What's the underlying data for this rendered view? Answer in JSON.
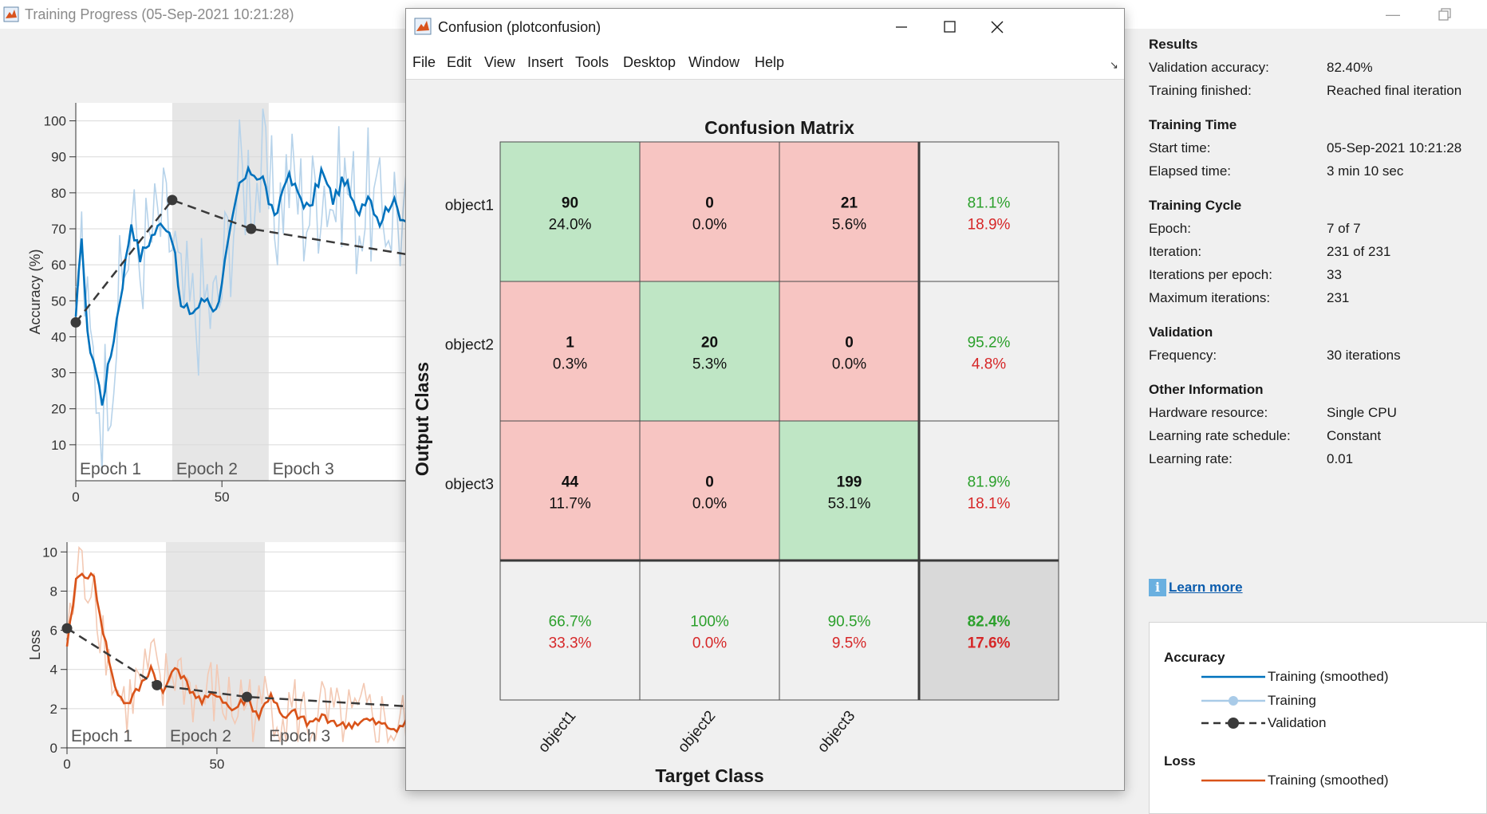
{
  "training_window": {
    "title": "Training Progress (05-Sep-2021 10:21:28)",
    "min_glyph": "—"
  },
  "accuracy_plot": {
    "ylabel": "Accuracy (%)",
    "y_ticks": [
      "10",
      "20",
      "30",
      "40",
      "50",
      "60",
      "70",
      "80",
      "90",
      "100"
    ],
    "x_ticks": [
      "0",
      "50"
    ],
    "epoch_labels": [
      "Epoch 1",
      "Epoch 2",
      "Epoch 3"
    ],
    "validation_points": [
      [
        0,
        44
      ],
      [
        33,
        78
      ],
      [
        60,
        70
      ]
    ]
  },
  "loss_plot": {
    "ylabel": "Loss",
    "y_ticks": [
      "0",
      "2",
      "4",
      "6",
      "8",
      "10"
    ],
    "x_ticks": [
      "0",
      "50"
    ],
    "epoch_labels": [
      "Epoch 1",
      "Epoch 2",
      "Epoch 3"
    ],
    "validation_points": [
      [
        0,
        6.1
      ],
      [
        30,
        3.2
      ],
      [
        60,
        2.6
      ]
    ]
  },
  "results": {
    "sections": [
      {
        "heading": "Results",
        "rows": [
          {
            "label": "Validation accuracy:",
            "value": "82.40%"
          },
          {
            "label": "Training finished:",
            "value": "Reached final iteration"
          }
        ]
      },
      {
        "heading": "Training Time",
        "rows": [
          {
            "label": "Start time:",
            "value": "05-Sep-2021 10:21:28"
          },
          {
            "label": "Elapsed time:",
            "value": "3 min 10 sec"
          }
        ]
      },
      {
        "heading": "Training Cycle",
        "rows": [
          {
            "label": "Epoch:",
            "value": "7 of 7"
          },
          {
            "label": "Iteration:",
            "value": "231 of 231"
          },
          {
            "label": "Iterations per epoch:",
            "value": "33"
          },
          {
            "label": "Maximum iterations:",
            "value": "231"
          }
        ]
      },
      {
        "heading": "Validation",
        "rows": [
          {
            "label": "Frequency:",
            "value": "30 iterations"
          }
        ]
      },
      {
        "heading": "Other Information",
        "rows": [
          {
            "label": "Hardware resource:",
            "value": "Single CPU"
          },
          {
            "label": "Learning rate schedule:",
            "value": "Constant"
          },
          {
            "label": "Learning rate:",
            "value": "0.01"
          }
        ]
      }
    ],
    "info_glyph": "i",
    "learn_more": "Learn more"
  },
  "legend": {
    "accuracy_heading": "Accuracy",
    "loss_heading": "Loss",
    "training_smoothed": "Training (smoothed)",
    "training": "Training",
    "validation": "Validation",
    "loss_training_smoothed": "Training (smoothed)"
  },
  "figure": {
    "title": "Confusion (plotconfusion)",
    "menu": [
      "File",
      "Edit",
      "View",
      "Insert",
      "Tools",
      "Desktop",
      "Window",
      "Help"
    ],
    "dock_glyph": "↘"
  },
  "chart_data": {
    "type": "heatmap",
    "title": "Confusion Matrix",
    "xlabel": "Target Class",
    "ylabel": "Output Class",
    "classes": [
      "object1",
      "object2",
      "object3"
    ],
    "counts": [
      [
        90,
        0,
        21
      ],
      [
        1,
        20,
        0
      ],
      [
        44,
        0,
        199
      ]
    ],
    "percents": [
      [
        "24.0%",
        "0.0%",
        "5.6%"
      ],
      [
        "0.3%",
        "5.3%",
        "0.0%"
      ],
      [
        "11.7%",
        "0.0%",
        "53.1%"
      ]
    ],
    "row_summary": [
      [
        "81.1%",
        "18.9%"
      ],
      [
        "95.2%",
        "4.8%"
      ],
      [
        "81.9%",
        "18.1%"
      ]
    ],
    "col_summary": [
      [
        "66.7%",
        "33.3%"
      ],
      [
        "100%",
        "0.0%"
      ],
      [
        "90.5%",
        "9.5%"
      ]
    ],
    "overall": [
      "82.4%",
      "17.6%"
    ],
    "colors": {
      "correct": "#bfe6c5",
      "incorrect": "#f7c5c2",
      "summary": "#f0f0f0",
      "overall": "#d9d9d9",
      "good_text": "#2ca02c",
      "bad_text": "#d62728"
    }
  }
}
